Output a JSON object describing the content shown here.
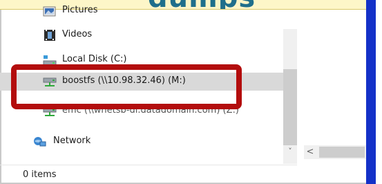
{
  "banner": {
    "title": "dumps"
  },
  "nav_tree": {
    "items": [
      {
        "label": "Pictures",
        "icon": "pictures-folder-icon"
      },
      {
        "label": "Videos",
        "icon": "videos-folder-icon"
      },
      {
        "label": "Local Disk (C:)",
        "icon": "local-disk-icon"
      },
      {
        "label": "boostfs (\\\\10.98.32.46) (M:)",
        "icon": "network-drive-icon"
      },
      {
        "label": "emc (\\\\wnetsb-dl.datadomain.com) (Z:)",
        "icon": "network-drive-icon"
      },
      {
        "label": "Network",
        "icon": "network-icon"
      }
    ]
  },
  "scroll": {
    "down_arrow": "˅",
    "left_arrow": "<"
  },
  "status_bar": {
    "item_count": "0 items"
  },
  "colors": {
    "highlight": "#b30d0d",
    "accent_blue": "#1431c8",
    "selected_row": "#d9d9d9"
  }
}
